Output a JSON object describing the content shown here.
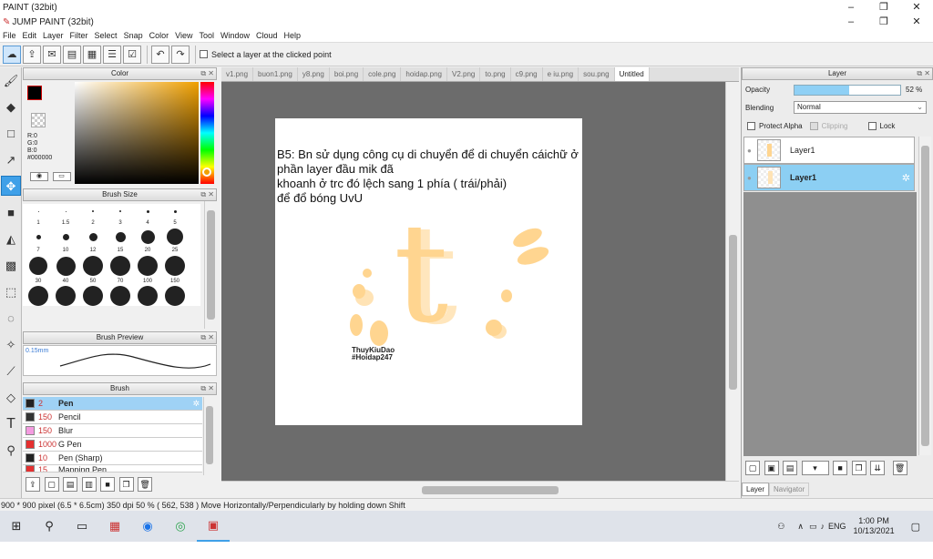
{
  "app": {
    "outer_title": "PAINT (32bit)",
    "inner_title": "JUMP PAINT (32bit)"
  },
  "menu": [
    "File",
    "Edit",
    "Layer",
    "Filter",
    "Select",
    "Snap",
    "Color",
    "View",
    "Tool",
    "Window",
    "Cloud",
    "Help"
  ],
  "toolbar": {
    "select_layer_label": "Select a layer at the clicked point"
  },
  "color_panel": {
    "title": "Color",
    "r": "R:0",
    "g": "G:0",
    "b": "B:0",
    "hex": "#000000"
  },
  "brush_size_panel": {
    "title": "Brush Size",
    "sizes": [
      "1",
      "1.5",
      "2",
      "3",
      "4",
      "5",
      "7",
      "10",
      "12",
      "15",
      "20",
      "25",
      "30",
      "40",
      "50",
      "70",
      "100",
      "150"
    ]
  },
  "brush_preview": {
    "title": "Brush Preview",
    "value": "0.15mm"
  },
  "brush_panel": {
    "title": "Brush",
    "items": [
      {
        "size": "2",
        "name": "Pen",
        "color": "#222222"
      },
      {
        "size": "150",
        "name": "Pencil",
        "color": "#333333"
      },
      {
        "size": "150",
        "name": "Blur",
        "color": "#f49be0"
      },
      {
        "size": "1000",
        "name": "G Pen",
        "color": "#e53030"
      },
      {
        "size": "10",
        "name": "Pen (Sharp)",
        "color": "#222222"
      },
      {
        "size": "15",
        "name": "Mapping Pen",
        "color": "#e53030"
      }
    ]
  },
  "tabs": [
    "v1.png",
    "buon1.png",
    "y8.png",
    "boi.png",
    "cole.png",
    "hoidap.png",
    "V2.png",
    "to.png",
    "c9.png",
    "e iu.png",
    "sou.png",
    "Untitled"
  ],
  "canvas": {
    "note": "B5: Bn sử dụng công cụ di chuyển để di chuyển cáichữ ở phần layer đầu mik đã\n khoanh ở trc đó lệch sang 1 phía ( trái/phải)\nđể đổ bóng UvU",
    "letter": "t",
    "watermark1": "ThuyKiuDao",
    "watermark2": "#Hoidap247"
  },
  "layer_panel": {
    "title": "Layer",
    "opacity_label": "Opacity",
    "opacity_value": "52 %",
    "opacity_fraction": 0.52,
    "blending_label": "Blending",
    "blending_value": "Normal",
    "protect_alpha": "Protect Alpha",
    "clipping": "Clipping",
    "lock": "Lock",
    "layers": [
      {
        "name": "Layer1"
      },
      {
        "name": "Layer1"
      }
    ],
    "tab_layer": "Layer",
    "tab_navigator": "Navigator"
  },
  "status": "900 * 900 pixel  (6.5 * 6.5cm)  350 dpi  50 %  ( 562, 538 )  Move Horizontally/Perpendicularly by holding down Shift",
  "taskbar": {
    "time": "1:00 PM",
    "date": "10/13/2021",
    "lang": "ENG"
  },
  "colors": {
    "accent": "#3fa0e8",
    "letter": "#ffd590",
    "canvas_bg": "#6c6c6c"
  }
}
